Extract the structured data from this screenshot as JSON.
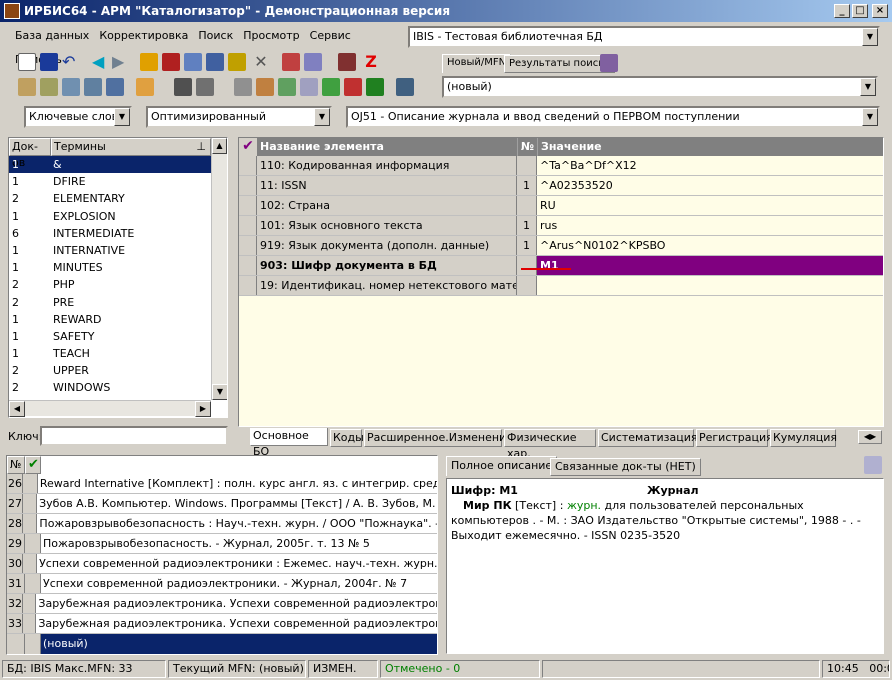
{
  "window": {
    "title": "ИРБИС64 - АРМ \"Каталогизатор\" - Демонстрационная версия"
  },
  "menu": [
    "База данных",
    "Корректировка",
    "Поиск",
    "Просмотр",
    "Сервис",
    "Помощь"
  ],
  "db_combo": {
    "value": "IBIS - Тестовая библиотечная БД"
  },
  "top_tabs": {
    "active": "Новый/MFN",
    "other": "Результаты поиска"
  },
  "mfn_combo": {
    "value": "(новый)"
  },
  "search_mode": {
    "value": "Ключевые слова"
  },
  "optimization": {
    "value": "Оптимизированный"
  },
  "worksheet_combo": {
    "value": "OJ51 - Описание журнала и ввод сведений о ПЕРВОМ поступлении"
  },
  "dictionary": {
    "headers": {
      "count": "Док-ов",
      "term": "Термины"
    },
    "rows": [
      [
        "1",
        "&"
      ],
      [
        "1",
        "DFIRE"
      ],
      [
        "2",
        "ELEMENTARY"
      ],
      [
        "1",
        "EXPLOSION"
      ],
      [
        "6",
        "INTERMEDIATE"
      ],
      [
        "1",
        "INTERNATIVE"
      ],
      [
        "1",
        "MINUTES"
      ],
      [
        "2",
        "PHP"
      ],
      [
        "2",
        "PRE"
      ],
      [
        "1",
        "REWARD"
      ],
      [
        "1",
        "SAFETY"
      ],
      [
        "1",
        "TEACH"
      ],
      [
        "2",
        "UPPER"
      ],
      [
        "2",
        "WINDOWS"
      ]
    ],
    "key_label": "Ключ:"
  },
  "worksheet": {
    "headers": {
      "name": "Название элемента",
      "num": "№",
      "value": "Значение"
    },
    "rows": [
      {
        "name": "110: Кодированная информация",
        "num": "",
        "value": "^Ta^Ba^Df^X12"
      },
      {
        "name": "11: ISSN",
        "num": "1",
        "value": "^A02353520"
      },
      {
        "name": "102: Страна",
        "num": "",
        "value": "RU"
      },
      {
        "name": "101: Язык основного текста",
        "num": "1",
        "value": "rus"
      },
      {
        "name": "919: Язык документа (дополн. данные)",
        "num": "1",
        "value": "^Arus^N0102^KPSBO"
      },
      {
        "name": "903: Шифр документа в БД",
        "num": "",
        "value": "М1"
      },
      {
        "name": "19: Идентификац. номер нетекстового матери",
        "num": "",
        "value": ""
      }
    ],
    "tabs": [
      "Основное БО",
      "Коды",
      "Расширенное.Изменения",
      "Физические хар.",
      "Систематизация",
      "Регистрация",
      "Кумуляция"
    ]
  },
  "records": {
    "header_num": "№",
    "rows": [
      [
        "26",
        "Reward Internative [Комплект] : полн. курс англ. яз. с интегрир. средствами"
      ],
      [
        "27",
        "Зубов А.В. Компьютер. Windows. Программы [Текст] / А. В. Зубов, М. В. Зубова"
      ],
      [
        "28",
        "Пожаровзрывобезопасность : Науч.-техн. журн. / ООО \"Пожнаука\". - Журнал"
      ],
      [
        "29",
        "Пожаровзрывобезопасность. - Журнал, 2005г. т. 13 № 5"
      ],
      [
        "30",
        "Успехи современной радиоэлектроники : Ежемес. науч.-техн. журн. - Журнал"
      ],
      [
        "31",
        "Успехи современной радиоэлектроники. - Журнал, 2004г. № 7"
      ],
      [
        "32",
        "Зарубежная радиоэлектроника. Успехи современной радиоэлектроники : Журнал"
      ],
      [
        "33",
        "Зарубежная радиоэлектроника. Успехи современной радиоэлектроники. - Журнал"
      ]
    ],
    "new_label": "(новый)"
  },
  "description": {
    "tabs": [
      "Полное описание",
      "Связанные док-ты (НЕТ)"
    ],
    "shifr": "Шифр: М1",
    "kind": "Журнал",
    "title": "Мир ПК",
    "gmd": " [Текст] : ",
    "subtitle": "журн.",
    "rest": " для пользователей персональных компьютеров . - М. : ЗАО Издательство \"Открытые системы\", 1988 -      . - Выходит ежемесячно. - ISSN 0235-3520"
  },
  "status": {
    "db": "БД: IBIS Макс.MFN: 33",
    "current": "Текущий MFN: (новый)",
    "changed": "ИЗМЕН.",
    "marked": "Отмечено - 0",
    "time": "10:45",
    "time2": "00:04"
  },
  "colors": {
    "selected": "#0a246a",
    "accent_purple": "#800080",
    "light_yellow": "#fffde7"
  }
}
